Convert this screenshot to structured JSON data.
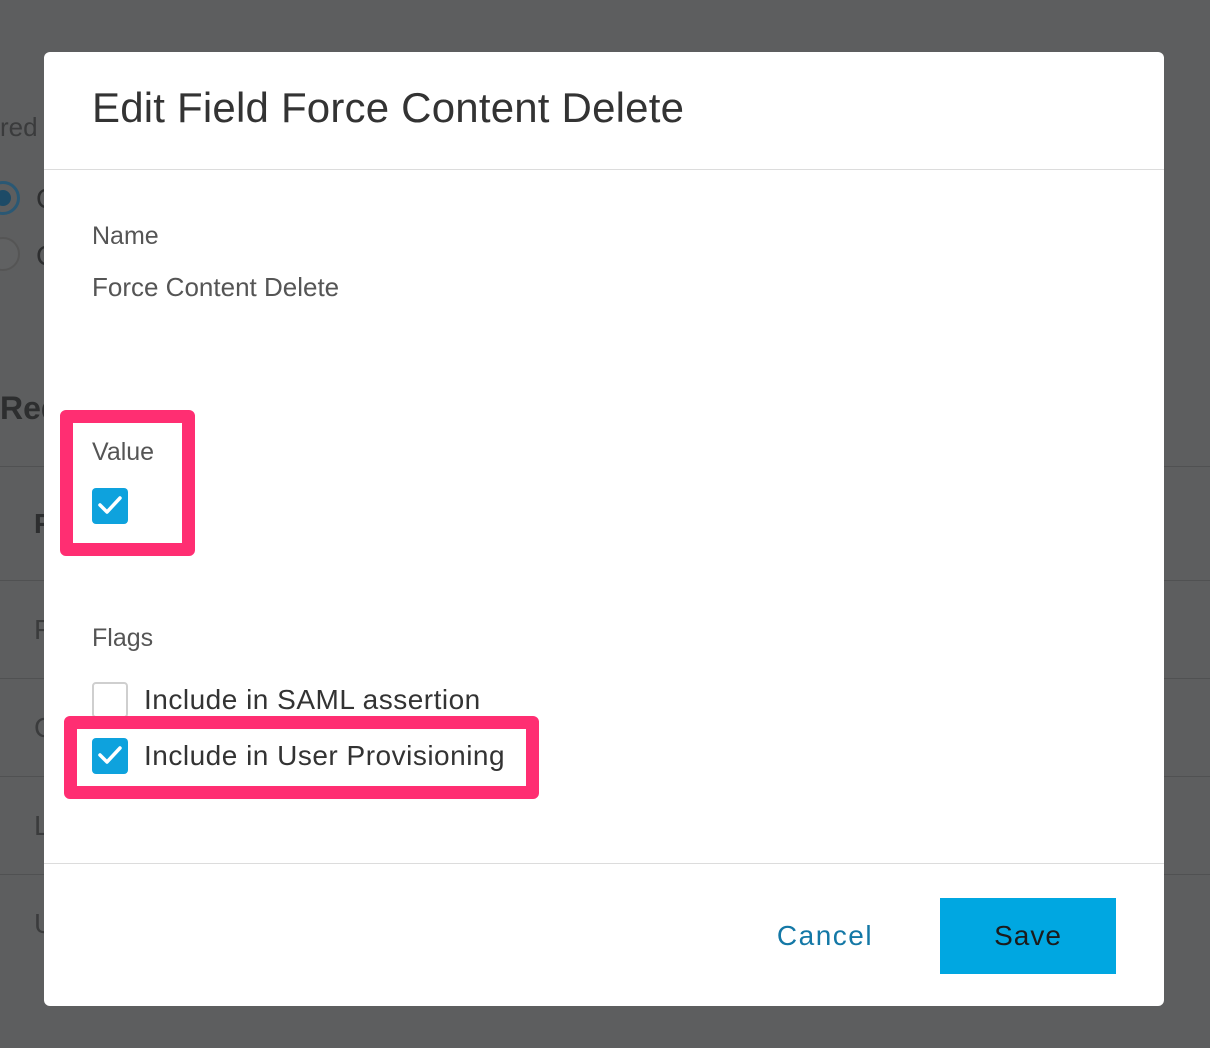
{
  "background": {
    "fragments": [
      "red",
      "C",
      "C",
      "Req",
      "F",
      "F",
      "C",
      "L",
      "U"
    ]
  },
  "dialog": {
    "title": "Edit Field Force Content Delete",
    "name_label": "Name",
    "name_value": "Force Content Delete",
    "value_label": "Value",
    "value_checked": true,
    "flags_label": "Flags",
    "flags": [
      {
        "label": "Include in SAML assertion",
        "checked": false
      },
      {
        "label": "Include in User Provisioning",
        "checked": true
      }
    ],
    "cancel_label": "Cancel",
    "save_label": "Save"
  },
  "colors": {
    "accent": "#00a7e1",
    "checkbox": "#0ea2dd",
    "link": "#1478a6",
    "highlight": "#ff2e72"
  }
}
